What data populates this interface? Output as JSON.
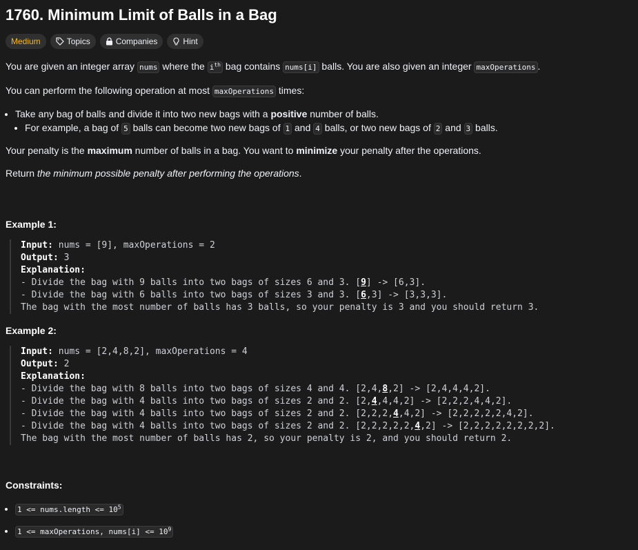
{
  "title": "1760. Minimum Limit of Balls in a Bag",
  "tags": {
    "difficulty": "Medium",
    "topics": "Topics",
    "companies": "Companies",
    "hint": "Hint"
  },
  "colors": {
    "difficulty": "#ffb800",
    "background": "#1b1b1b"
  },
  "icons": [
    "tag-icon",
    "lock-icon",
    "lightbulb-icon"
  ],
  "desc": {
    "p1_a": "You are given an integer array ",
    "nums": "nums",
    "p1_b": " where the ",
    "ith_base": "i",
    "ith_sup": "th",
    "p1_c": " bag contains ",
    "nums_i": "nums[i]",
    "p1_d": " balls. You are also given an integer ",
    "maxOps": "maxOperations",
    "p1_e": ".",
    "p2_a": "You can perform the following operation at most ",
    "p2_b": " times:",
    "li1_a": "Take any bag of balls and divide it into two new bags with a ",
    "li1_bold": "positive",
    "li1_b": " number of balls.",
    "li2_a": "For example, a bag of ",
    "v5": "5",
    "li2_b": " balls can become two new bags of ",
    "v1": "1",
    "li2_c": " and ",
    "v4": "4",
    "li2_d": " balls, or two new bags of ",
    "v2": "2",
    "li2_e": " and ",
    "v3": "3",
    "li2_f": " balls.",
    "p3_a": "Your penalty is the ",
    "p3_bold1": "maximum",
    "p3_b": " number of balls in a bag. You want to ",
    "p3_bold2": "minimize",
    "p3_c": " your penalty after the operations.",
    "p4_a": "Return ",
    "p4_i": "the minimum possible penalty after performing the operations",
    "p4_b": "."
  },
  "examples": [
    {
      "title": "Example 1:",
      "input_label": "Input:",
      "input": " nums = [9], maxOperations = 2",
      "output_label": "Output:",
      "output": " 3",
      "expl_label": "Explanation:",
      "lines": [
        {
          "pre": "- Divide the bag with 9 balls into two bags of sizes 6 and 3. [",
          "hl": "9",
          "post": "] -> [6,3]."
        },
        {
          "pre": "- Divide the bag with 6 balls into two bags of sizes 3 and 3. [",
          "hl": "6",
          "post": ",3] -> [3,3,3]."
        }
      ],
      "final": "The bag with the most number of balls has 3 balls, so your penalty is 3 and you should return 3."
    },
    {
      "title": "Example 2:",
      "input_label": "Input:",
      "input": " nums = [2,4,8,2], maxOperations = 4",
      "output_label": "Output:",
      "output": " 2",
      "expl_label": "Explanation:",
      "lines": [
        {
          "pre": "- Divide the bag with 8 balls into two bags of sizes 4 and 4. [2,4,",
          "hl": "8",
          "post": ",2] -> [2,4,4,4,2]."
        },
        {
          "pre": "- Divide the bag with 4 balls into two bags of sizes 2 and 2. [2,",
          "hl": "4",
          "post": ",4,4,2] -> [2,2,2,4,4,2]."
        },
        {
          "pre": "- Divide the bag with 4 balls into two bags of sizes 2 and 2. [2,2,2,",
          "hl": "4",
          "post": ",4,2] -> [2,2,2,2,2,4,2]."
        },
        {
          "pre": "- Divide the bag with 4 balls into two bags of sizes 2 and 2. [2,2,2,2,2,",
          "hl": "4",
          "post": ",2] -> [2,2,2,2,2,2,2,2]."
        }
      ],
      "final": "The bag with the most number of balls has 2, so your penalty is 2, and you should return 2."
    }
  ],
  "constraints": {
    "title": "Constraints:",
    "c1_a": "1 <= nums.length <= 10",
    "c1_sup": "5",
    "c2_a": "1 <= maxOperations, nums[i] <= 10",
    "c2_sup": "9"
  }
}
